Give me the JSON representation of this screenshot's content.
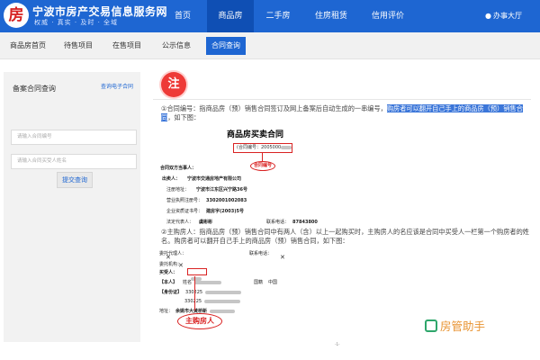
{
  "header": {
    "logo_glyph": "房",
    "title": "宁波市房产交易信息服务网",
    "slogan": "权威 · 真实 · 及时 · 全域",
    "nav": [
      {
        "label": "首页",
        "active": false
      },
      {
        "label": "商品房",
        "active": true
      },
      {
        "label": "二手房",
        "active": false
      },
      {
        "label": "住房租赁",
        "active": false
      },
      {
        "label": "信用评价",
        "active": false
      }
    ],
    "office_label": "办事大厅",
    "office_icon": "user-icon"
  },
  "subnav": {
    "items": [
      {
        "label": "商品房首页",
        "active": false
      },
      {
        "label": "待售项目",
        "active": false
      },
      {
        "label": "在售项目",
        "active": false
      },
      {
        "label": "公示信息",
        "active": false
      },
      {
        "label": "合同查询",
        "active": true
      }
    ]
  },
  "sidebar": {
    "title": "备案合同查询",
    "link": "查询电子合同",
    "contract_placeholder": "请输入合同编号",
    "buyer_placeholder": "请输入合同买受人姓名",
    "button": "提交查询"
  },
  "note": {
    "badge": "注",
    "para1_prefix": "①合同编号：指商品房（预）销售合同签订及网上备案后自动生成的一串编号，",
    "para1_highlight": "购房者可以翻开自己手上的商品房（预）销售合同",
    "para1_suffix": "，如下图：",
    "para2": "②主购房人：指商品房（预）销售合同中有两人（含）以上一起购买时，主购房人的名应该是合同中买受人一栏第一个购房者的姓名。购房者可以翻开自己手上的商品房（预）销售合同，如下图："
  },
  "doc1": {
    "title": "商品房买卖合同",
    "contract_no_label": "(合同编号：",
    "contract_no_value": "2005000",
    "oval_label": "合同编号",
    "parties_title": "合同双方当事人：",
    "seller_label": "出卖人：",
    "seller_value": "宁波市交通房地产有限公司",
    "address_label": "注册地址：",
    "address_value": "宁波市江东区兴宁路36号",
    "license_label": "营业执照注册号：",
    "license_value": "3302001002083",
    "cert_label": "企业资质证书号：",
    "cert_value": "建房字(2003)5号",
    "rep_label": "法定代表人：",
    "rep_value": "虞彬彬",
    "phone_label": "联系电话：",
    "phone_value": "87843800"
  },
  "doc2": {
    "rep_label": "委托代理人：",
    "phone_label": "联系电话：",
    "agency_label": "委托机构：",
    "buyer_label": "买受人：",
    "person_label": "【本人】",
    "person_name_label": "姓名",
    "nationality_label": "国籍",
    "nationality_value": "中国",
    "id_label": "【身份证】",
    "id_value": "330225",
    "address_label": "地址：",
    "address_value": "余姚市大黄桥新",
    "oval_label": "主购房人"
  },
  "watermark": {
    "label": "房管助手",
    "icon": "app-logo-icon"
  },
  "page_number": "-1-",
  "colors": {
    "primary": "#1e66d2",
    "accent_red": "#ee3a37",
    "watermark_orange": "#e89331"
  }
}
